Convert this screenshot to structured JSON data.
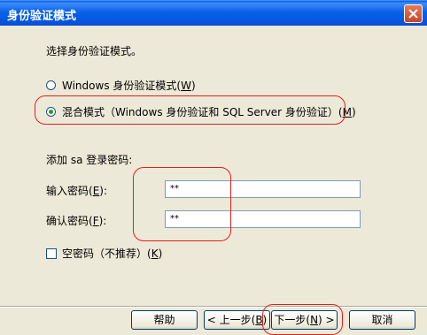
{
  "window": {
    "title": "身份验证模式"
  },
  "heading": "选择身份验证模式。",
  "options": [
    {
      "label": "Windows 身份验证模式(",
      "key": "W",
      "suffix": ")",
      "selected": false
    },
    {
      "label": "混合模式（Windows 身份验证和 SQL Server 身份验证）(",
      "key": "M",
      "suffix": ")",
      "selected": true
    }
  ],
  "password_section": {
    "title": "添加 sa 登录密码:",
    "enter": {
      "label": "输入密码(",
      "key": "E",
      "suffix": "):",
      "value": "**"
    },
    "confirm": {
      "label": "确认密码(",
      "key": "F",
      "suffix": "):",
      "value": "**"
    }
  },
  "blank_password": {
    "label": "空密码（不推荐）(",
    "key": "K",
    "suffix": ")",
    "checked": false
  },
  "buttons": {
    "help": "帮助",
    "back": {
      "label": "< 上一步(",
      "key": "B",
      "suffix": ")"
    },
    "next": {
      "label": "下一步(",
      "key": "N",
      "suffix": ") >"
    },
    "cancel": "取消"
  },
  "colors": {
    "highlight": "#e0201c",
    "title_bar": "#0a5ee8",
    "dialog_bg": "#ece9d8"
  }
}
